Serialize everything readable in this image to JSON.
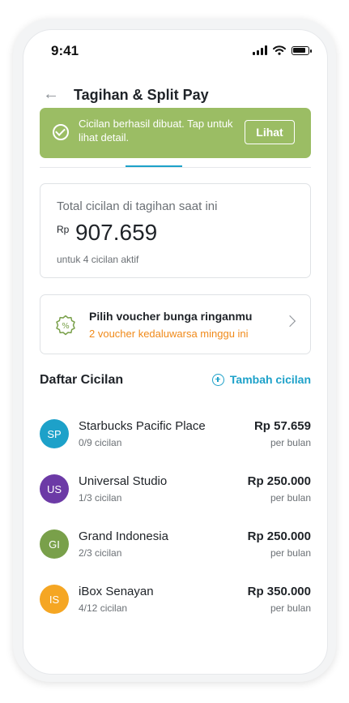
{
  "status": {
    "time": "9:41"
  },
  "header": {
    "title": "Tagihan & Split Pay"
  },
  "toast": {
    "message": "Cicilan berhasil dibuat. Tap untuk lihat detail.",
    "action_label": "Lihat",
    "color": "#9bbd64"
  },
  "summary": {
    "label": "Total cicilan di tagihan saat ini",
    "currency": "Rp",
    "amount": "907.659",
    "subtitle": "untuk 4 cicilan aktif"
  },
  "voucher": {
    "title": "Pilih voucher bunga ringanmu",
    "subtitle": "2 voucher kedaluwarsa minggu ini",
    "accent": "#f08a1a"
  },
  "list": {
    "title": "Daftar Cicilan",
    "add_label": "Tambah cicilan",
    "accent": "#1da1c9",
    "items": [
      {
        "initials": "SP",
        "name": "Starbucks Pacific Place",
        "progress": "0/9 cicilan",
        "amount": "Rp 57.659",
        "period": "per bulan",
        "color": "#1da1c9"
      },
      {
        "initials": "US",
        "name": "Universal Studio",
        "progress": "1/3 cicilan",
        "amount": "Rp 250.000",
        "period": "per bulan",
        "color": "#6c3aa6"
      },
      {
        "initials": "GI",
        "name": "Grand Indonesia",
        "progress": "2/3 cicilan",
        "amount": "Rp 250.000",
        "period": "per bulan",
        "color": "#79a04a"
      },
      {
        "initials": "IS",
        "name": "iBox Senayan",
        "progress": "4/12 cicilan",
        "amount": "Rp 350.000",
        "period": "per bulan",
        "color": "#f5a623"
      }
    ]
  }
}
